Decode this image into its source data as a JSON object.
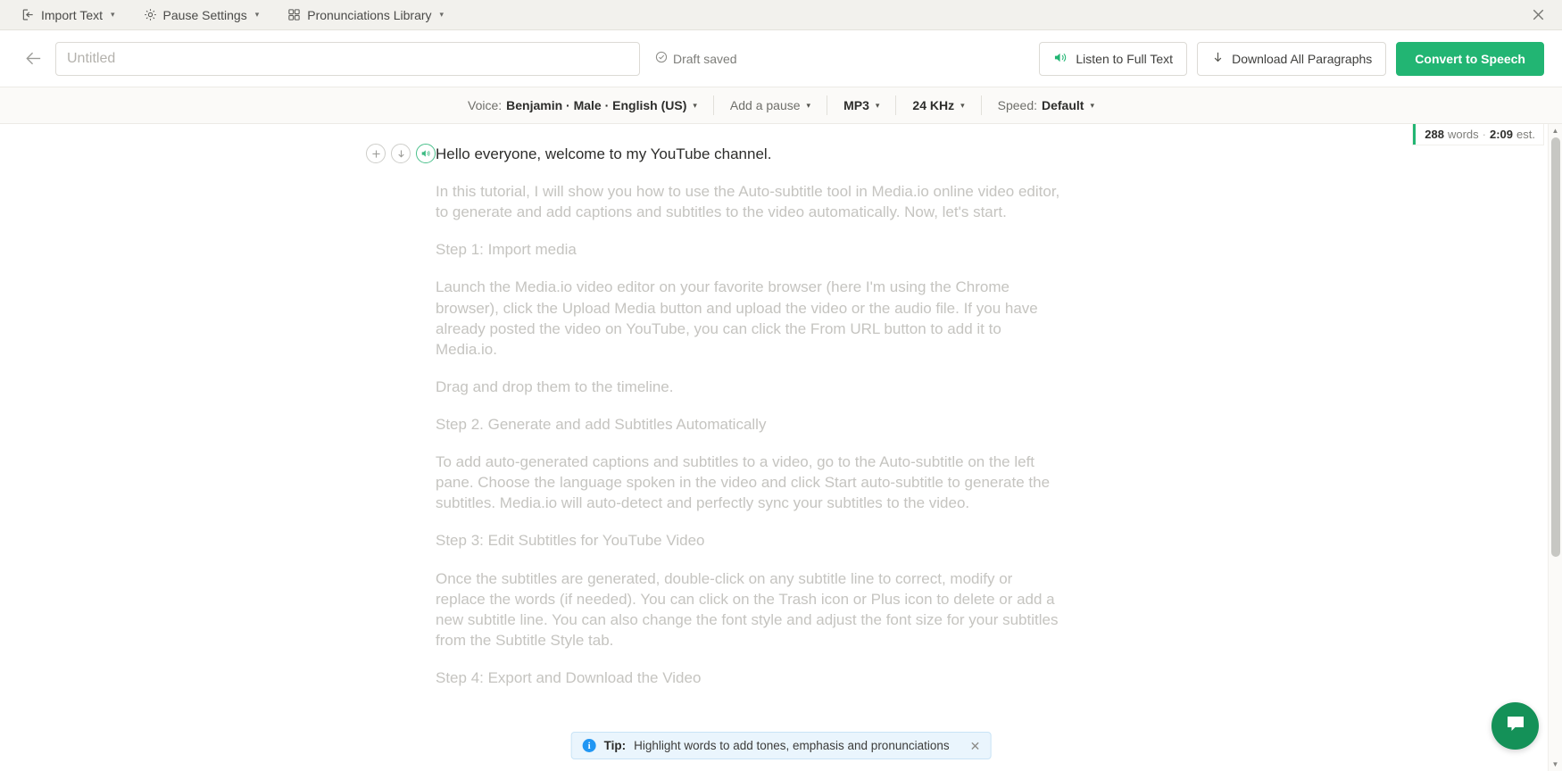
{
  "menubar": {
    "items": [
      {
        "label": "Import Text",
        "icon": "import-text-icon",
        "caret": "▾"
      },
      {
        "label": "Pause Settings",
        "icon": "gear-icon",
        "caret": "▾"
      },
      {
        "label": "Pronunciations Library",
        "icon": "grid-icon",
        "caret": "▾"
      }
    ],
    "close_label": "✕"
  },
  "header": {
    "back_label": "←",
    "title_value": "",
    "title_placeholder": "Untitled",
    "draft_status": "Draft saved",
    "listen_label": "Listen to Full Text",
    "download_label": "Download All Paragraphs",
    "convert_label": "Convert to Speech"
  },
  "voicebar": {
    "voice_label": "Voice:",
    "voice_value": "Benjamin · Male · English (US)",
    "add_pause": "Add a pause",
    "format": "MP3",
    "sample_rate": "24 KHz",
    "speed_label": "Speed:",
    "speed_value": "Default",
    "caret": "▾"
  },
  "editor": {
    "wordcount_number": "288",
    "wordcount_words": "words",
    "wordcount_sep": "·",
    "wordcount_time": "2:09",
    "wordcount_est": "est.",
    "paragraph_controls": {
      "add": "+",
      "download": "↓",
      "play": "🔊"
    },
    "paragraphs": [
      {
        "text": "Hello everyone, welcome to my YouTube channel.",
        "active": true,
        "has_controls": true
      },
      {
        "text": "In this tutorial, I will show you how to use the Auto-subtitle tool in Media.io online video editor, to generate and add captions and subtitles to the video automatically. Now, let's start.",
        "active": false,
        "has_controls": false
      },
      {
        "text": "Step 1: Import media",
        "active": false,
        "has_controls": false
      },
      {
        "text": "Launch the Media.io video editor on your favorite browser (here I'm using the Chrome browser), click the Upload Media button and upload the video or the audio file. If you have already posted the video on YouTube, you can click the From URL button to add it to Media.io.",
        "active": false,
        "has_controls": false
      },
      {
        "text": "Drag and drop them to the timeline.",
        "active": false,
        "has_controls": false
      },
      {
        "text": "Step 2. Generate and add Subtitles Automatically",
        "active": false,
        "has_controls": false
      },
      {
        "text": "To add auto-generated captions and subtitles to a video, go to the Auto-subtitle on the left pane. Choose the language spoken in the video and click Start auto-subtitle to generate the subtitles. Media.io will auto-detect and perfectly sync your subtitles to the video.",
        "active": false,
        "has_controls": false
      },
      {
        "text": "Step 3: Edit Subtitles for YouTube Video",
        "active": false,
        "has_controls": false
      },
      {
        "text": "Once the subtitles are generated, double-click on any subtitle line to correct, modify or replace the words (if needed). You can click on the Trash icon or Plus icon to delete or add a new subtitle line. You can also change the font style and adjust the font size for your subtitles from the Subtitle Style tab.",
        "active": false,
        "has_controls": false
      },
      {
        "text": "Step 4: Export and Download the Video",
        "active": false,
        "has_controls": false
      }
    ]
  },
  "tip": {
    "prefix": "Tip:",
    "message": "Highlight words to add tones, emphasis and pronunciations",
    "close": "✕"
  },
  "chat": {
    "label": "chat-bubble-icon"
  },
  "colors": {
    "accent_green": "#22b573",
    "chat_green": "#149158",
    "tip_blue": "#2196f3",
    "menubar_bg": "#f2f1ed"
  }
}
